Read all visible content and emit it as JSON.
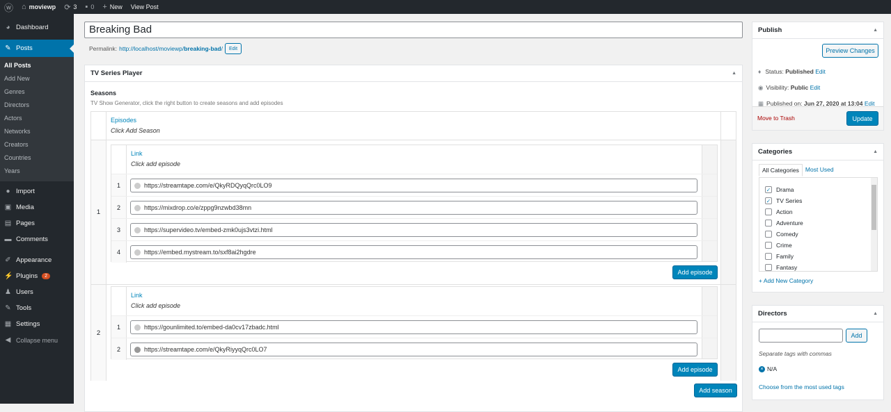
{
  "adminbar": {
    "site": "moviewp",
    "updates": "3",
    "comments": "0",
    "new": "New",
    "view": "View Post"
  },
  "sidebar": {
    "dashboard": "Dashboard",
    "posts": "Posts",
    "posts_sub": [
      "All Posts",
      "Add New",
      "Genres",
      "Directors",
      "Actors",
      "Networks",
      "Creators",
      "Countries",
      "Years"
    ],
    "items": [
      "Import",
      "Media",
      "Pages",
      "Comments",
      "Appearance",
      "Plugins",
      "Users",
      "Tools",
      "Settings",
      "Collapse menu"
    ],
    "plugins_badge": "2"
  },
  "post": {
    "title": "Breaking Bad",
    "permalink_label": "Permalink:",
    "permalink_base": "http://localhost/moviewp/",
    "permalink_slug": "breaking-bad",
    "permalink_end": "/",
    "edit": "Edit"
  },
  "player": {
    "title": "TV Series Player",
    "seasons_label": "Seasons",
    "seasons_desc": "TV Show Generator, click the right button to create seasons and add episodes",
    "episodes_label": "Episodes",
    "episodes_hint": "Click Add Season",
    "link_label": "Link",
    "link_hint": "Click add episode",
    "add_episode": "Add episode",
    "add_season": "Add season",
    "seasons": [
      {
        "number": "1",
        "episodes": [
          "https://streamtape.com/e/QkyRDQyqQrc0LO9",
          "https://mixdrop.co/e/zppg9nzwbd38mn",
          "https://supervideo.tv/embed-zmk0ujs3vtzi.html",
          "https://embed.mystream.to/sxf8ai2hgdre"
        ]
      },
      {
        "number": "2",
        "episodes": [
          "https://gounlimited.to/embed-da0cv17zbadc.html",
          "https://streamtape.com/e/QkyRiyyqQrc0LO7"
        ]
      }
    ]
  },
  "publish": {
    "title": "Publish",
    "preview": "Preview Changes",
    "status_label": "Status:",
    "status": "Published",
    "visibility_label": "Visibility:",
    "visibility": "Public",
    "published_label": "Published on:",
    "published": "Jun 27, 2020 at 13:04",
    "edit": "Edit",
    "trash": "Move to Trash",
    "update": "Update"
  },
  "categories": {
    "title": "Categories",
    "tab_all": "All Categories",
    "tab_used": "Most Used",
    "items": [
      {
        "name": "Drama",
        "checked": true
      },
      {
        "name": "TV Series",
        "checked": true
      },
      {
        "name": "Action",
        "checked": false
      },
      {
        "name": "Adventure",
        "checked": false
      },
      {
        "name": "Comedy",
        "checked": false
      },
      {
        "name": "Crime",
        "checked": false
      },
      {
        "name": "Family",
        "checked": false
      },
      {
        "name": "Fantasy",
        "checked": false
      }
    ],
    "add_new": "+ Add New Category"
  },
  "directors": {
    "title": "Directors",
    "add": "Add",
    "hint": "Separate tags with commas",
    "tag": "N/A",
    "choose": "Choose from the most used tags"
  }
}
